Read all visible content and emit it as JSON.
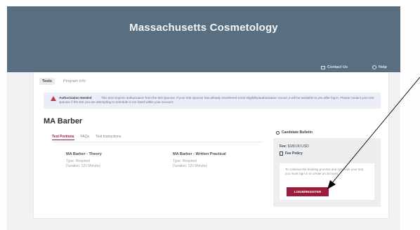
{
  "header": {
    "title": "Massachusetts Cosmetology",
    "contact_label": "Contact Us",
    "help_label": "Help"
  },
  "tabs": [
    {
      "label": "Tests",
      "active": true
    },
    {
      "label": "Program Info",
      "active": false
    }
  ],
  "alert": {
    "title": "Authorization Needed",
    "message": "This test requires authorization from the test sponsor. If your test sponsor has already transferred a test eligibility/authorization record, it will be available to you after log in. Please contact your test sponsor if the test you are attempting to schedule is not listed within your account."
  },
  "page_title": "MA Barber",
  "sub_tabs": [
    "Test Portions",
    "FAQs",
    "Test Instructions"
  ],
  "portions": [
    {
      "name": "MA Barber - Theory",
      "type": "Type: Required",
      "duration": "Duration: 120 Minutes"
    },
    {
      "name": "MA Barber - Written Practical",
      "type": "Type: Required",
      "duration": "Duration: 120 Minutes"
    }
  ],
  "sidebar": {
    "bulletin_label": "Candidate Bulletin",
    "fee_label": "Fee:",
    "fee_value": "$180.00 USD",
    "fee_policy_label": "Fee Policy",
    "login_prompt": "To continue the booking process and schedule your test, you must sign in or create an account.",
    "login_button": "LOGIN/REGISTER"
  },
  "colors": {
    "header_bg": "#5a6e82",
    "accent": "#9b1c3c",
    "warning": "#b33a4a"
  }
}
